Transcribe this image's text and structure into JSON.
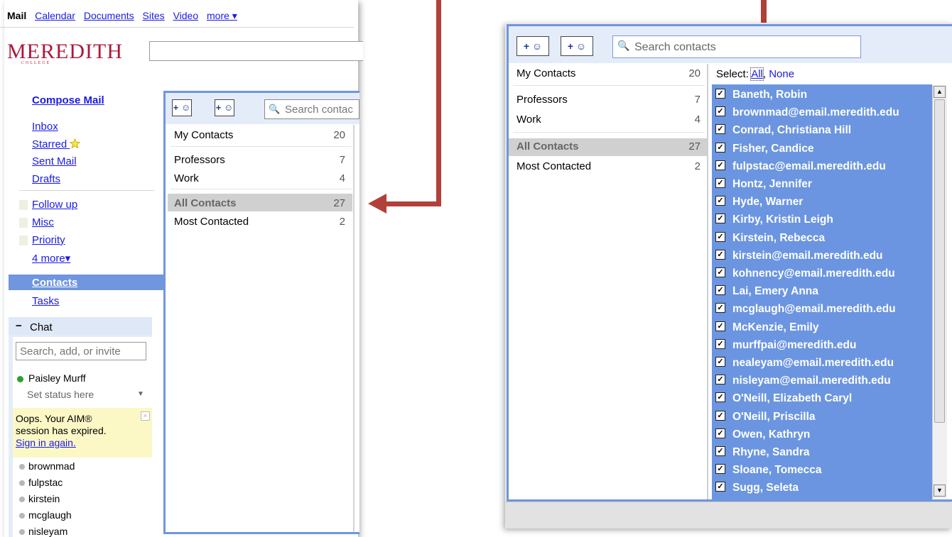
{
  "left": {
    "topnav": [
      {
        "label": "Mail",
        "current": true
      },
      {
        "label": "Calendar"
      },
      {
        "label": "Documents"
      },
      {
        "label": "Sites"
      },
      {
        "label": "Video"
      },
      {
        "label": "more ▾"
      }
    ],
    "logo": "MEREDITH",
    "logo_sub": "COLLEGE",
    "nav": {
      "compose": "Compose Mail",
      "inbox": "Inbox",
      "starred": "Starred",
      "sent": "Sent Mail",
      "drafts": "Drafts",
      "labels": [
        "Follow up",
        "Misc",
        "Priority"
      ],
      "more": "4 more▾",
      "contacts": "Contacts",
      "tasks": "Tasks"
    },
    "chat": {
      "title": "Chat",
      "search_placeholder": "Search, add, or invite",
      "user": "Paisley Murff",
      "status": "Set status here",
      "aim_line1": "Oops. Your AIM®",
      "aim_line2": "session has expired.",
      "aim_link": "Sign in again.",
      "buddies": [
        "brownmad",
        "fulpstac",
        "kirstein",
        "mcglaugh",
        "nisleyam"
      ]
    },
    "contacts_panel": {
      "search_placeholder": "Search contac",
      "groups": [
        {
          "name": "My Contacts",
          "count": "20"
        },
        {
          "name": "Professors",
          "count": "7"
        },
        {
          "name": "Work",
          "count": "4"
        },
        {
          "name": "All Contacts",
          "count": "27"
        },
        {
          "name": "Most Contacted",
          "count": "2"
        }
      ]
    }
  },
  "right": {
    "search_placeholder": "Search contacts",
    "groups": [
      {
        "name": "My Contacts",
        "count": "20"
      },
      {
        "name": "Professors",
        "count": "7"
      },
      {
        "name": "Work",
        "count": "4"
      },
      {
        "name": "All Contacts",
        "count": "27"
      },
      {
        "name": "Most Contacted",
        "count": "2"
      }
    ],
    "select_label": "Select:",
    "select_all": "All",
    "select_none": "None",
    "contacts": [
      "Baneth, Robin",
      "brownmad@email.meredith.edu",
      "Conrad, Christiana Hill",
      "Fisher, Candice",
      "fulpstac@email.meredith.edu",
      "Hontz, Jennifer",
      "Hyde, Warner",
      "Kirby, Kristin Leigh",
      "Kirstein, Rebecca",
      "kirstein@email.meredith.edu",
      "kohnency@email.meredith.edu",
      "Lai, Emery Anna",
      "mcglaugh@email.meredith.edu",
      "McKenzie, Emily",
      "murffpai@meredith.edu",
      "nealeyam@email.meredith.edu",
      "nisleyam@email.meredith.edu",
      "O'Neill, Elizabeth Caryl",
      "O'Neill, Priscilla",
      "Owen, Kathryn",
      "Rhyne, Sandra",
      "Sloane, Tomecca",
      "Sugg, Seleta"
    ]
  },
  "colors": {
    "accent_blue": "#6f96de",
    "selection_blue": "#6b95e0",
    "logo_red": "#b0173a",
    "arrow_red": "#b0403a"
  }
}
